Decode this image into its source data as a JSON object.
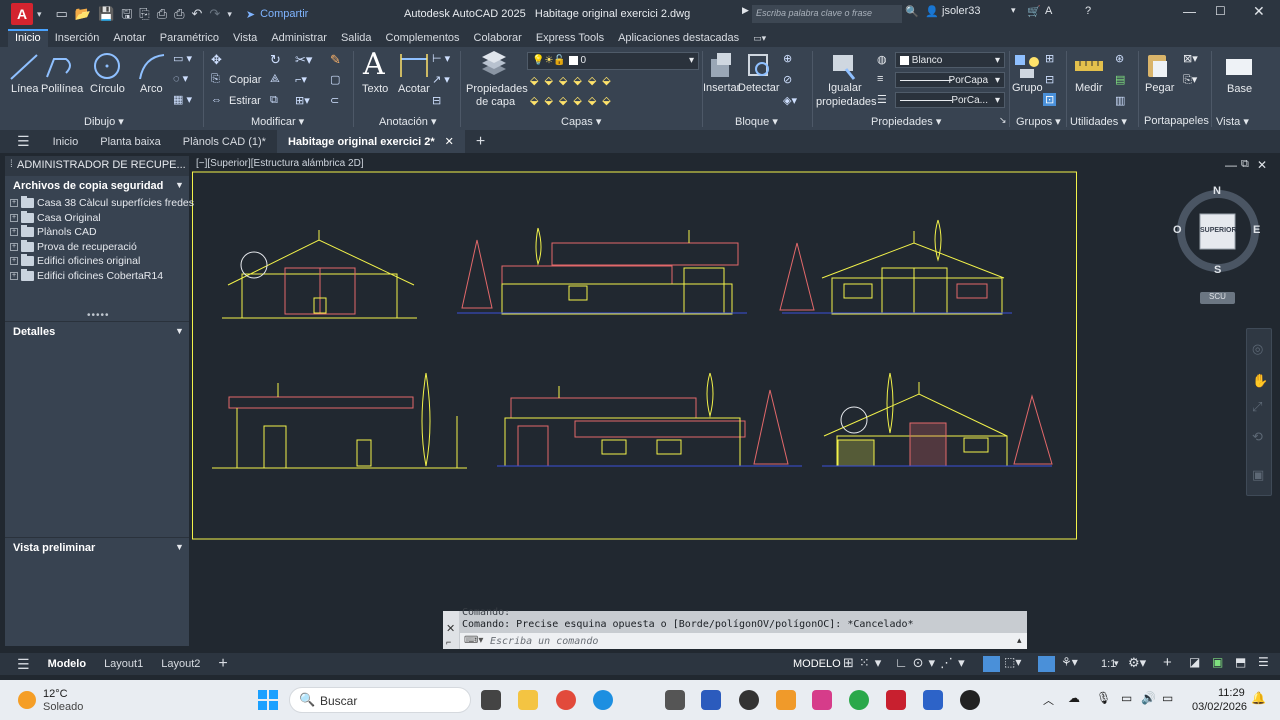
{
  "title_bar": {
    "app_title": "Autodesk AutoCAD 2025",
    "file_title": "Habitage original exercici 2.dwg",
    "share_label": "Compartir",
    "search_placeholder": "Escriba palabra clave o frase",
    "user": "jsoler33"
  },
  "ribbon_tabs": [
    "Inicio",
    "Inserción",
    "Anotar",
    "Paramétrico",
    "Vista",
    "Administrar",
    "Salida",
    "Complementos",
    "Colaborar",
    "Express Tools",
    "Aplicaciones destacadas"
  ],
  "ribbon": {
    "linea": "Línea",
    "polilinea": "Polilínea",
    "circulo": "Círculo",
    "arco": "Arco",
    "copiar": "Copiar",
    "estirar": "Estirar",
    "texto": "Texto",
    "acotar": "Acotar",
    "propiedades_capa_1": "Propiedades",
    "propiedades_capa_2": "de capa",
    "layer_value": "0",
    "insertar": "Insertar",
    "detectar": "Detectar",
    "igualar_1": "Igualar",
    "igualar_2": "propiedades",
    "color_value": "Blanco",
    "linetype_value": "PorCapa",
    "lineweight_value": "PorCa...",
    "grupo": "Grupo",
    "medir": "Medir",
    "pegar": "Pegar",
    "base": "Base",
    "panels": {
      "dibujo": "Dibujo",
      "modificar": "Modificar",
      "anotacion": "Anotación",
      "capas": "Capas",
      "bloque": "Bloque",
      "propiedades": "Propiedades",
      "grupos": "Grupos",
      "utilidades": "Utilidades",
      "portapapeles": "Portapapeles",
      "vista": "Vista"
    }
  },
  "doc_tabs": {
    "inicio": "Inicio",
    "planta": "Planta baixa",
    "planols": "Plànols CAD (1)*",
    "active": "Habitage original exercici 2*"
  },
  "palette": {
    "title": "ADMINISTRADOR DE RECUPE...",
    "backup_header": "Archivos de copia seguridad",
    "items": [
      "Casa 38 Càlcul superfícies fredes",
      "Casa Original",
      "Plànols CAD",
      "Prova de recuperació",
      "Edifici oficines original",
      "Edifici oficines CobertaR14"
    ],
    "details_header": "Detalles",
    "preview_header": "Vista preliminar"
  },
  "viewport": {
    "label": "[−][Superior][Estructura alámbrica 2D]",
    "viewcube_face": "SUPERIOR",
    "compass_n": "N",
    "compass_s": "S",
    "compass_e": "E",
    "compass_o": "O",
    "ucs": "SCU"
  },
  "command": {
    "line1": "Comando:",
    "line2": "Comando: Precise esquina opuesta o [Borde/polígonOV/polígonOC]: *Cancelado*",
    "placeholder": "Escriba un comando"
  },
  "status_bar": {
    "modelo_tab": "Modelo",
    "layout1": "Layout1",
    "layout2": "Layout2",
    "modelo": "MODELO",
    "scale": "1:1"
  },
  "taskbar": {
    "temp": "12°C",
    "weather": "Soleado",
    "search": "Buscar",
    "time": "11:29",
    "date": "03/02/2026"
  },
  "colors": {
    "accent": "#4aa3ff",
    "drawing_yellow": "#f2f24a",
    "drawing_red": "#e2686a",
    "background": "#212830"
  }
}
